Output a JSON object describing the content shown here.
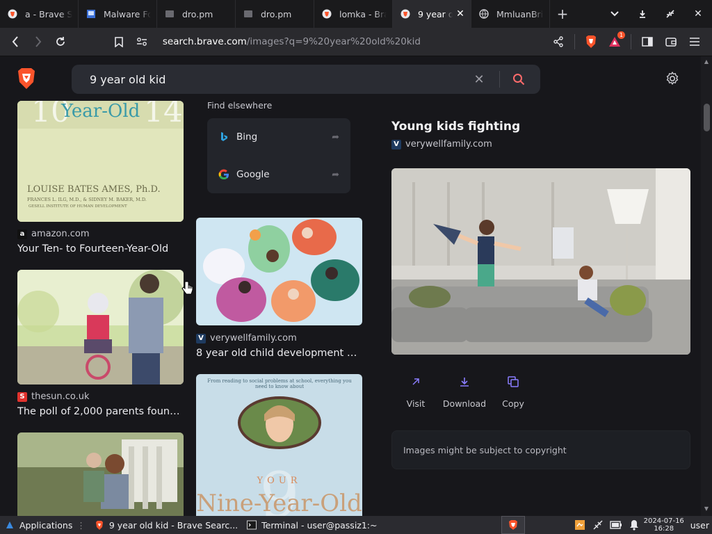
{
  "browser": {
    "tabs": [
      {
        "title": "a - Brave Se",
        "icon": "brave-icon",
        "active": false
      },
      {
        "title": "Malware Fo",
        "icon": "doc-icon",
        "active": false
      },
      {
        "title": "dro.pm",
        "icon": "page-icon",
        "active": false
      },
      {
        "title": "dro.pm",
        "icon": "page-icon",
        "active": false
      },
      {
        "title": "lomka - Bra",
        "icon": "brave-icon",
        "active": false
      },
      {
        "title": "9 year o",
        "icon": "brave-icon",
        "active": true
      },
      {
        "title": "MmluanBri",
        "icon": "globe-icon",
        "active": false
      }
    ],
    "url_host": "search.brave.com",
    "url_path": "/images?q=9%20year%20old%20kid",
    "notification_count": "1"
  },
  "search": {
    "query": "9 year old kid"
  },
  "results": {
    "col1": [
      {
        "source": "amazon.com",
        "title": "Your Ten- to Fourteen-Year-Old",
        "fav_letter": "a",
        "fav_color": "#111111",
        "img_text_top": "Year-Old",
        "img_author": "LOUISE BATES AMES, Ph.D.",
        "img_coauthors": "FRANCES L. ILG, M.D., & SIDNEY M. BAKER, M.D.",
        "img_institute": "GESELL INSTITUTE OF HUMAN DEVELOPMENT"
      },
      {
        "source": "thesun.co.uk",
        "title": "The poll of 2,000 parents found th...",
        "fav_letter": "S",
        "fav_color": "#e0322d"
      },
      {
        "source": "",
        "title": ""
      }
    ],
    "col2_elsewhere": {
      "label": "Find elsewhere",
      "items": [
        {
          "name": "Bing"
        },
        {
          "name": "Google"
        }
      ]
    },
    "col2": [
      {
        "source": "verywellfamily.com",
        "title": "8 year old child development miles...",
        "fav_letter": "V",
        "fav_color": "#1e3a5f"
      },
      {
        "img_text_top": "YOUR",
        "img_text_big": "Nine-Year-Old",
        "img_blurb": "From reading to social problems at school, everything you need to know about"
      }
    ]
  },
  "detail": {
    "title": "Young kids fighting",
    "source": "verywellfamily.com",
    "actions": [
      {
        "label": "Visit",
        "icon": "external-link-icon"
      },
      {
        "label": "Download",
        "icon": "download-icon"
      },
      {
        "label": "Copy",
        "icon": "copy-icon"
      }
    ],
    "copyright": "Images might be subject to copyright"
  },
  "taskbar": {
    "apps_label": "Applications",
    "windows": [
      {
        "label": "9 year old kid - Brave Searc...",
        "icon": "brave-icon"
      },
      {
        "label": "Terminal - user@passiz1:~",
        "icon": "terminal-icon"
      }
    ],
    "date": "2024-07-16",
    "time": "16:28",
    "user": "user"
  },
  "colors": {
    "brave_orange": "#fb542b",
    "accent_purple": "#8a7dff",
    "search_icon": "#ff6b6b"
  }
}
